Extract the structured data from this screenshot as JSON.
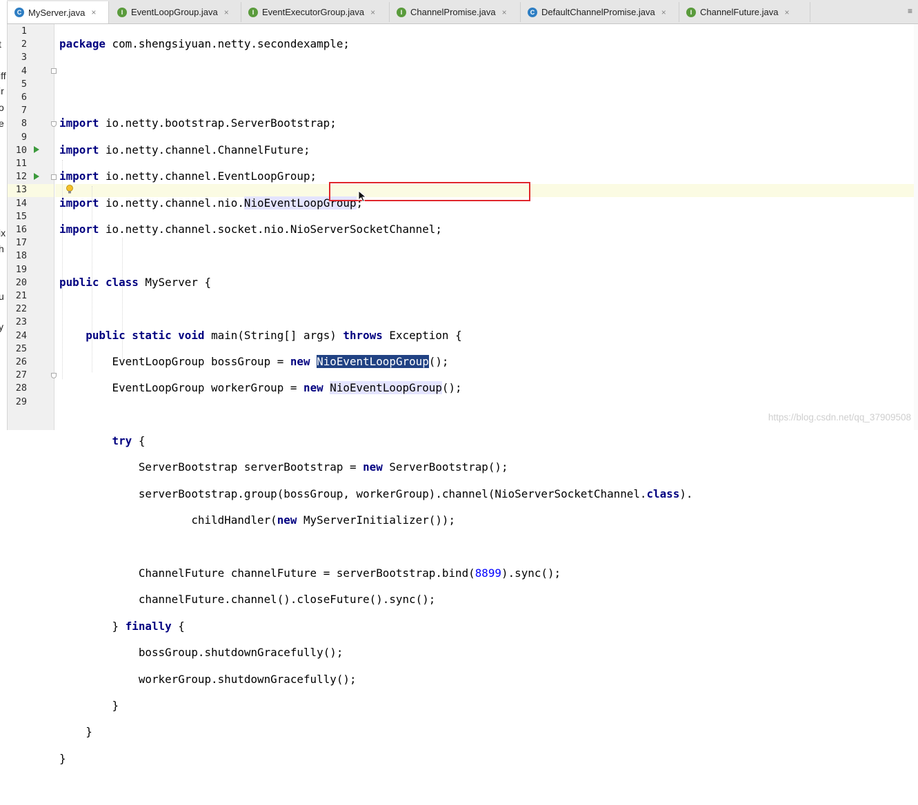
{
  "left_panel_fragments": [
    "t",
    "iff",
    "ir",
    "o",
    "e",
    "ix",
    "h",
    "u",
    "y"
  ],
  "tabs": [
    {
      "label": "MyServer.java",
      "icon": "class-icon",
      "active": true
    },
    {
      "label": "EventLoopGroup.java",
      "icon": "interface-icon",
      "active": false
    },
    {
      "label": "EventExecutorGroup.java",
      "icon": "interface-icon",
      "active": false
    },
    {
      "label": "ChannelPromise.java",
      "icon": "interface-icon",
      "active": false
    },
    {
      "label": "DefaultChannelPromise.java",
      "icon": "class-icon",
      "active": false
    },
    {
      "label": "ChannelFuture.java",
      "icon": "interface-icon",
      "active": false
    }
  ],
  "tab_close_glyph": "×",
  "tab_overflow_glyph": "≡",
  "line_numbers": [
    "1",
    "2",
    "3",
    "4",
    "5",
    "6",
    "7",
    "8",
    "9",
    "10",
    "11",
    "12",
    "13",
    "14",
    "15",
    "16",
    "17",
    "18",
    "19",
    "20",
    "21",
    "22",
    "23",
    "24",
    "25",
    "26",
    "27",
    "28",
    "29"
  ],
  "current_line": 13,
  "code": {
    "l1_kw": "package",
    "l1_rest": " com.shengsiyuan.netty.secondexample;",
    "import_kw": "import",
    "l4": " io.netty.bootstrap.ServerBootstrap;",
    "l5": " io.netty.channel.ChannelFuture;",
    "l6": " io.netty.channel.EventLoopGroup;",
    "l7_a": " io.netty.channel.nio.",
    "l7_b": "NioEventLoopGroup",
    "l7_c": ";",
    "l8": " io.netty.channel.socket.nio.NioServerSocketChannel;",
    "l10_kw": "public class",
    "l10_rest": " MyServer {",
    "l12_kw1": "public static void",
    "l12_a": " main(String[] args) ",
    "l12_kw2": "throws",
    "l12_b": " Exception {",
    "l13_a": "EventLoopGroup bossGroup = ",
    "new_kw": "new",
    "l13_sel": "NioEventLoopGroup",
    "l13_b": "();",
    "l14_a": "EventLoopGroup workerGroup = ",
    "l14_hl": "NioEventLoopGroup",
    "l14_b": "();",
    "try_kw": "try",
    "l16_b": " {",
    "l17_a": "ServerBootstrap serverBootstrap = ",
    "l17_b": " ServerBootstrap();",
    "l18_a": "serverBootstrap.group(bossGroup, workerGroup).channel(NioServerSocketChannel.",
    "class_kw": "class",
    "l18_b": ").",
    "l19_a": "childHandler(",
    "l19_b": " MyServerInitializer());",
    "l21_a": "ChannelFuture channelFuture = serverBootstrap.bind(",
    "l21_num": "8899",
    "l21_b": ").sync();",
    "l22": "channelFuture.channel().closeFuture().sync();",
    "l23_a": "} ",
    "finally_kw": "finally",
    "l23_b": " {",
    "l24": "bossGroup.shutdownGracefully();",
    "l25": "workerGroup.shutdownGracefully();",
    "close": "}"
  },
  "watermark": "https://blog.csdn.net/qq_37909508",
  "colors": {
    "keyword": "#000080",
    "number": "#0000ff",
    "selection": "#214283",
    "annotation_box": "#e0262b"
  }
}
